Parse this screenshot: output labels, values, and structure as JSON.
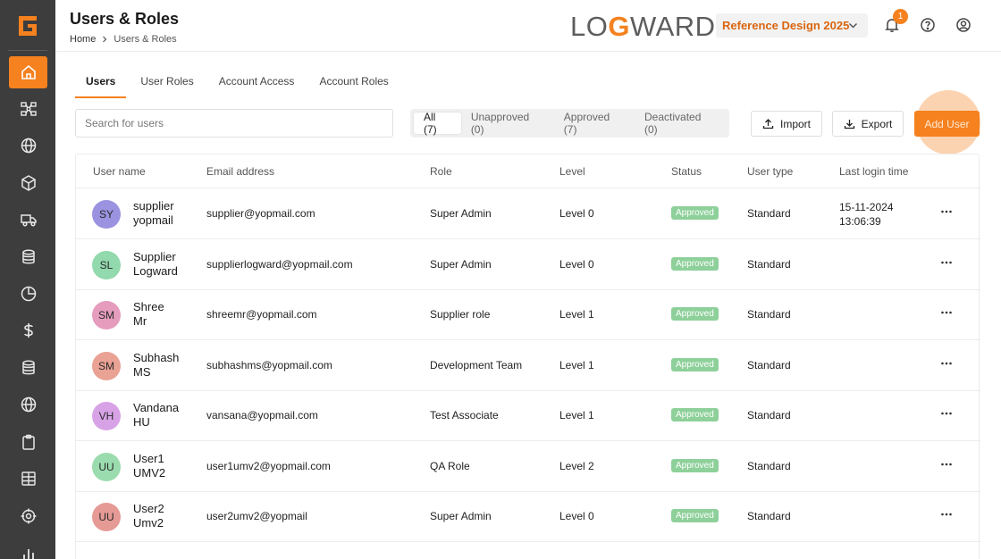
{
  "header": {
    "title": "Users & Roles",
    "breadcrumb": {
      "home": "Home",
      "current": "Users & Roles"
    },
    "brand": {
      "prefix": "LO",
      "g": "G",
      "suffix": "WARD"
    },
    "reference_select": "Reference Design 2025",
    "notification_count": "1"
  },
  "tabs": [
    {
      "label": "Users"
    },
    {
      "label": "User Roles"
    },
    {
      "label": "Account Access"
    },
    {
      "label": "Account Roles"
    }
  ],
  "toolbar": {
    "search_placeholder": "Search for users",
    "filters": [
      {
        "label": "All (7)"
      },
      {
        "label": "Unapproved (0)"
      },
      {
        "label": "Approved (7)"
      },
      {
        "label": "Deactivated (0)"
      }
    ],
    "import_label": "Import",
    "export_label": "Export",
    "add_user_label": "Add User"
  },
  "table": {
    "columns": [
      "User name",
      "Email address",
      "Role",
      "Level",
      "Status",
      "User type",
      "Last login time"
    ],
    "rows": [
      {
        "initials": "SY",
        "avatar_color": "#9b93e0",
        "first": "supplier",
        "last": "yopmail",
        "email": "supplier@yopmail.com",
        "role": "Super Admin",
        "level": "Level 0",
        "status": "Approved",
        "type": "Standard",
        "login_date": "15-11-2024",
        "login_time": "13:06:39"
      },
      {
        "initials": "SL",
        "avatar_color": "#92d9ad",
        "first": "Supplier",
        "last": "Logward",
        "email": "supplierlogward@yopmail.com",
        "role": "Super Admin",
        "level": "Level 0",
        "status": "Approved",
        "type": "Standard",
        "login_date": "",
        "login_time": ""
      },
      {
        "initials": "SM",
        "avatar_color": "#e59cbd",
        "first": "Shree",
        "last": "Mr",
        "email": "shreemr@yopmail.com",
        "role": "Supplier role",
        "level": "Level 1",
        "status": "Approved",
        "type": "Standard",
        "login_date": "",
        "login_time": ""
      },
      {
        "initials": "SM",
        "avatar_color": "#e9a294",
        "first": "Subhash",
        "last": "MS",
        "email": "subhashms@yopmail.com",
        "role": "Development Team",
        "level": "Level 1",
        "status": "Approved",
        "type": "Standard",
        "login_date": "",
        "login_time": ""
      },
      {
        "initials": "VH",
        "avatar_color": "#d8a3e6",
        "first": "Vandana",
        "last": "HU",
        "email": "vansana@yopmail.com",
        "role": "Test Associate",
        "level": "Level 1",
        "status": "Approved",
        "type": "Standard",
        "login_date": "",
        "login_time": ""
      },
      {
        "initials": "UU",
        "avatar_color": "#9bdcaf",
        "first": "User1",
        "last": "UMV2",
        "email": "user1umv2@yopmail.com",
        "role": "QA Role",
        "level": "Level 2",
        "status": "Approved",
        "type": "Standard",
        "login_date": "",
        "login_time": ""
      },
      {
        "initials": "UU",
        "avatar_color": "#e59a95",
        "first": "User2",
        "last": "Umv2",
        "email": "user2umv2@yopmail",
        "role": "Super Admin",
        "level": "Level 0",
        "status": "Approved",
        "type": "Standard",
        "login_date": "",
        "login_time": ""
      }
    ]
  },
  "colors": {
    "accent": "#f5811f",
    "sidebar": "#3d3d3d",
    "approved": "#8ed09a"
  },
  "sidebar": {
    "icons": [
      "home-icon",
      "network-icon",
      "globe-icon",
      "package-icon",
      "truck-icon",
      "database-icon",
      "pie-chart-icon",
      "dollar-icon",
      "database-icon",
      "globe-icon",
      "clipboard-icon",
      "grid-icon",
      "target-icon",
      "bar-chart-icon"
    ]
  }
}
